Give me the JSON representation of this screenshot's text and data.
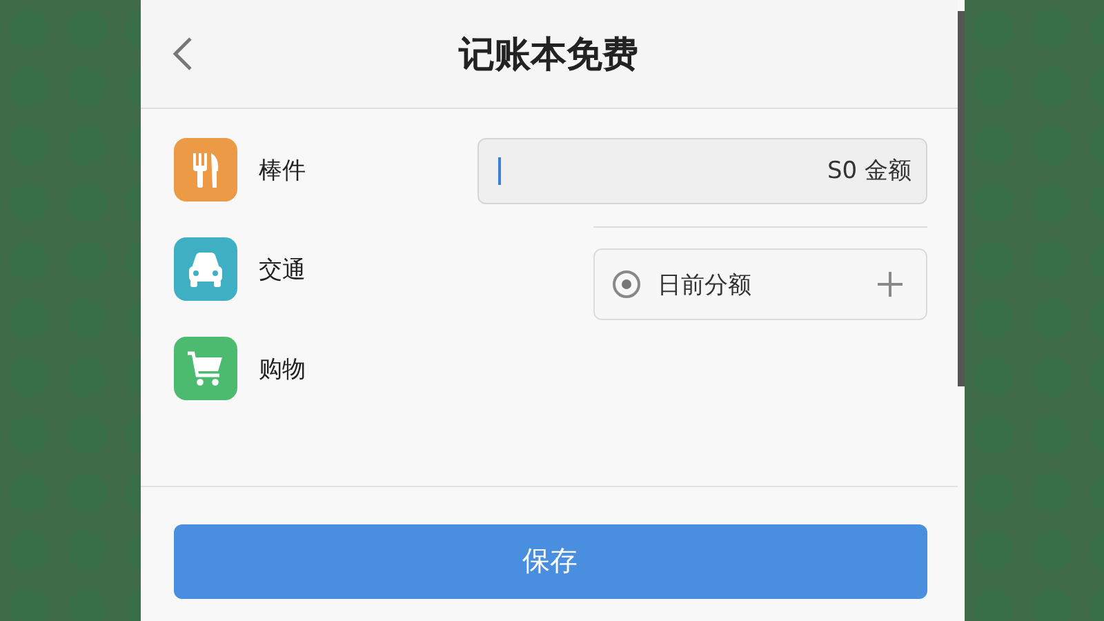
{
  "header": {
    "title": "记账本免费"
  },
  "categories": [
    {
      "label": "棒件",
      "kind": "food"
    },
    {
      "label": "交通",
      "kind": "transport"
    },
    {
      "label": "购物",
      "kind": "shopping"
    }
  ],
  "amount": {
    "placeholder": "S0 金额"
  },
  "category_field": {
    "text": "日前分额"
  },
  "save_button": {
    "label": "保存"
  }
}
